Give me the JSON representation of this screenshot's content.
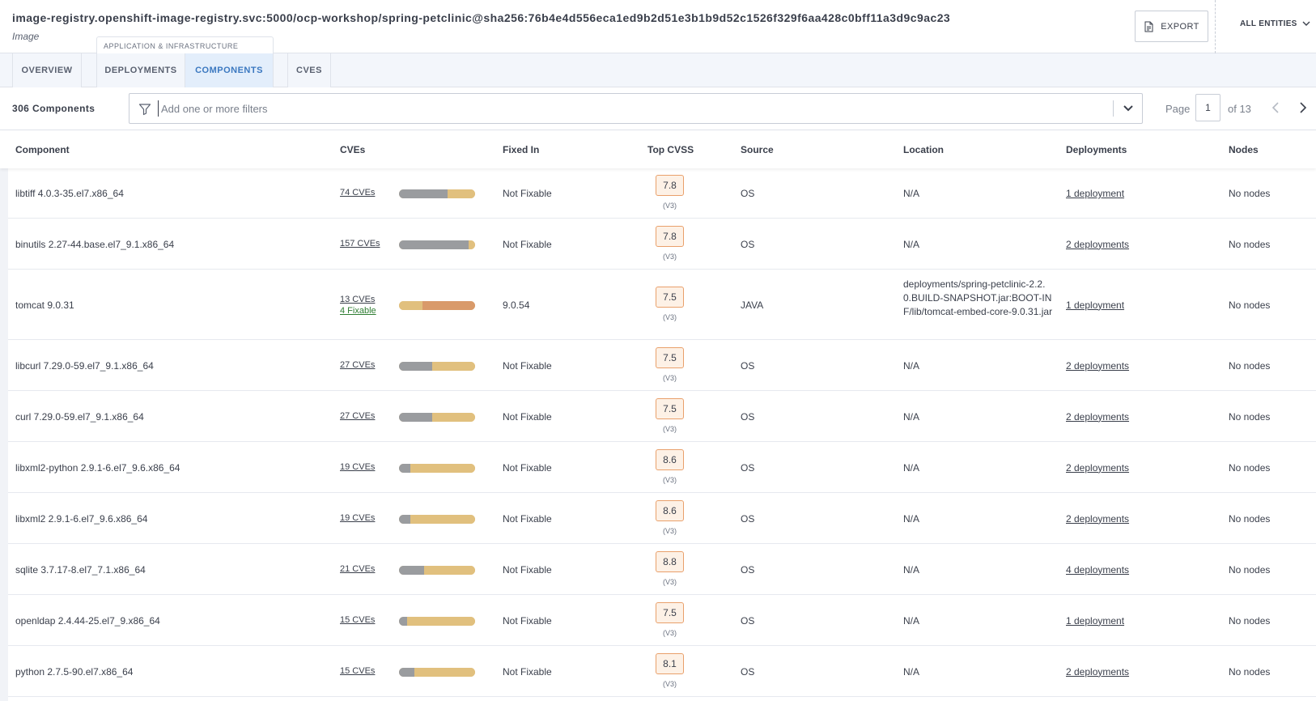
{
  "header": {
    "title": "image-registry.openshift-image-registry.svc:5000/ocp-workshop/spring-petclinic@sha256:76b4e4d556eca1ed9b2d51e3b1b9d52c1526f329f6aa428c0bff11a3d9c9ac23",
    "subtitle": "Image",
    "export_label": "Export",
    "entities_label": "All Entities"
  },
  "tab_group_label": "Application & Infrastructure",
  "tabs": [
    {
      "label": "Overview"
    },
    {
      "label": "Deployments"
    },
    {
      "label": "Components"
    },
    {
      "label": "CVEs"
    }
  ],
  "toolbar": {
    "count_label": "306 Components",
    "filter_placeholder": "Add one or more filters",
    "page_label": "Page",
    "page_value": "1",
    "page_of": "of 13"
  },
  "columns": [
    "Component",
    "CVEs",
    "Fixed In",
    "Top CVSS",
    "Source",
    "Location",
    "Deployments",
    "Nodes"
  ],
  "colors": {
    "bar_gray": "#9a9c9f",
    "bar_yellow": "#e1c07e",
    "bar_orange": "#d99a6a",
    "cvss_border": "#e9a06b",
    "cvss_bg": "#fdf1e6",
    "fixable_green": "#2e7d32",
    "active_tab": "#3b78c0"
  },
  "rows": [
    {
      "component": "libtiff 4.0.3-35.el7.x86_64",
      "cves": "74 CVEs",
      "fixable": "",
      "bar": [
        {
          "color": "#9a9c9f",
          "frac": 0.64
        },
        {
          "color": "#e1c07e",
          "frac": 0.36
        }
      ],
      "fixed_in": "Not Fixable",
      "cvss": "7.8",
      "cvss_ver": "(V3)",
      "source": "OS",
      "location": "N/A",
      "deployments": "1 deployment",
      "nodes": "No nodes"
    },
    {
      "component": "binutils 2.27-44.base.el7_9.1.x86_64",
      "cves": "157 CVEs",
      "fixable": "",
      "bar": [
        {
          "color": "#9a9c9f",
          "frac": 0.91
        },
        {
          "color": "#e1c07e",
          "frac": 0.09
        }
      ],
      "fixed_in": "Not Fixable",
      "cvss": "7.8",
      "cvss_ver": "(V3)",
      "source": "OS",
      "location": "N/A",
      "deployments": "2 deployments",
      "nodes": "No nodes"
    },
    {
      "component": "tomcat 9.0.31",
      "cves": "13 CVEs",
      "fixable": "4 Fixable",
      "bar": [
        {
          "color": "#e1c07e",
          "frac": 0.31
        },
        {
          "color": "#d99a6a",
          "frac": 0.69
        }
      ],
      "fixed_in": "9.0.54",
      "cvss": "7.5",
      "cvss_ver": "(V3)",
      "source": "JAVA",
      "location": "deployments/spring-petclinic-2.2.0.BUILD-SNAPSHOT.jar:BOOT-INF/lib/tomcat-embed-core-9.0.31.jar",
      "deployments": "1 deployment",
      "nodes": "No nodes"
    },
    {
      "component": "libcurl 7.29.0-59.el7_9.1.x86_64",
      "cves": "27 CVEs",
      "fixable": "",
      "bar": [
        {
          "color": "#9a9c9f",
          "frac": 0.44
        },
        {
          "color": "#e1c07e",
          "frac": 0.56
        }
      ],
      "fixed_in": "Not Fixable",
      "cvss": "7.5",
      "cvss_ver": "(V3)",
      "source": "OS",
      "location": "N/A",
      "deployments": "2 deployments",
      "nodes": "No nodes"
    },
    {
      "component": "curl 7.29.0-59.el7_9.1.x86_64",
      "cves": "27 CVEs",
      "fixable": "",
      "bar": [
        {
          "color": "#9a9c9f",
          "frac": 0.44
        },
        {
          "color": "#e1c07e",
          "frac": 0.56
        }
      ],
      "fixed_in": "Not Fixable",
      "cvss": "7.5",
      "cvss_ver": "(V3)",
      "source": "OS",
      "location": "N/A",
      "deployments": "2 deployments",
      "nodes": "No nodes"
    },
    {
      "component": "libxml2-python 2.9.1-6.el7_9.6.x86_64",
      "cves": "19 CVEs",
      "fixable": "",
      "bar": [
        {
          "color": "#9a9c9f",
          "frac": 0.15
        },
        {
          "color": "#e1c07e",
          "frac": 0.85
        }
      ],
      "fixed_in": "Not Fixable",
      "cvss": "8.6",
      "cvss_ver": "(V3)",
      "source": "OS",
      "location": "N/A",
      "deployments": "2 deployments",
      "nodes": "No nodes"
    },
    {
      "component": "libxml2 2.9.1-6.el7_9.6.x86_64",
      "cves": "19 CVEs",
      "fixable": "",
      "bar": [
        {
          "color": "#9a9c9f",
          "frac": 0.15
        },
        {
          "color": "#e1c07e",
          "frac": 0.85
        }
      ],
      "fixed_in": "Not Fixable",
      "cvss": "8.6",
      "cvss_ver": "(V3)",
      "source": "OS",
      "location": "N/A",
      "deployments": "2 deployments",
      "nodes": "No nodes"
    },
    {
      "component": "sqlite 3.7.17-8.el7_7.1.x86_64",
      "cves": "21 CVEs",
      "fixable": "",
      "bar": [
        {
          "color": "#9a9c9f",
          "frac": 0.33
        },
        {
          "color": "#e1c07e",
          "frac": 0.67
        }
      ],
      "fixed_in": "Not Fixable",
      "cvss": "8.8",
      "cvss_ver": "(V3)",
      "source": "OS",
      "location": "N/A",
      "deployments": "4 deployments",
      "nodes": "No nodes"
    },
    {
      "component": "openldap 2.4.44-25.el7_9.x86_64",
      "cves": "15 CVEs",
      "fixable": "",
      "bar": [
        {
          "color": "#9a9c9f",
          "frac": 0.11
        },
        {
          "color": "#e1c07e",
          "frac": 0.89
        }
      ],
      "fixed_in": "Not Fixable",
      "cvss": "7.5",
      "cvss_ver": "(V3)",
      "source": "OS",
      "location": "N/A",
      "deployments": "1 deployment",
      "nodes": "No nodes"
    },
    {
      "component": "python 2.7.5-90.el7.x86_64",
      "cves": "15 CVEs",
      "fixable": "",
      "bar": [
        {
          "color": "#9a9c9f",
          "frac": 0.2
        },
        {
          "color": "#e1c07e",
          "frac": 0.8
        }
      ],
      "fixed_in": "Not Fixable",
      "cvss": "8.1",
      "cvss_ver": "(V3)",
      "source": "OS",
      "location": "N/A",
      "deployments": "2 deployments",
      "nodes": "No nodes"
    }
  ]
}
